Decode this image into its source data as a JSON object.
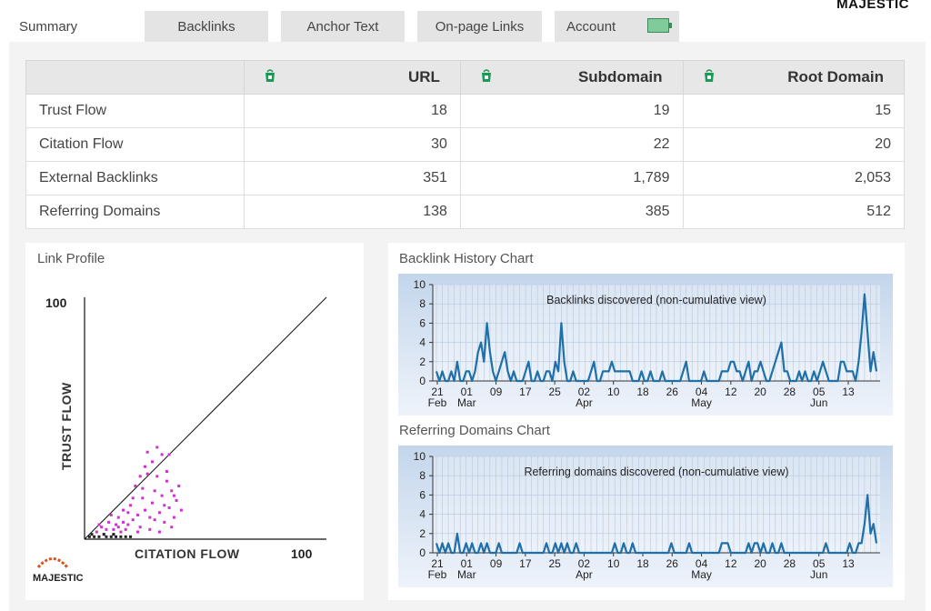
{
  "brand": "MAJESTIC",
  "tabs": [
    {
      "label": "Summary",
      "active": true
    },
    {
      "label": "Backlinks",
      "active": false
    },
    {
      "label": "Anchor Text",
      "active": false
    },
    {
      "label": "On-page Links",
      "active": false
    },
    {
      "label": "Account",
      "active": false,
      "icon": "battery-icon"
    }
  ],
  "metrics_table": {
    "columns": [
      "URL",
      "Subdomain",
      "Root Domain"
    ],
    "column_icon": "bucket-icon",
    "rows": [
      {
        "label": "Trust Flow",
        "values": [
          "18",
          "19",
          "15"
        ]
      },
      {
        "label": "Citation Flow",
        "values": [
          "30",
          "22",
          "20"
        ]
      },
      {
        "label": "External Backlinks",
        "values": [
          "351",
          "1,789",
          "2,053"
        ]
      },
      {
        "label": "Referring Domains",
        "values": [
          "138",
          "385",
          "512"
        ]
      }
    ]
  },
  "link_profile": {
    "title": "Link Profile",
    "y_label": "TRUST FLOW",
    "x_label": "CITATION FLOW",
    "y_max_label": "100",
    "x_max_label": "100",
    "logo_text": "MAJESTIC",
    "dot_color": "#cc33cc",
    "points": [
      [
        5,
        3
      ],
      [
        7,
        5
      ],
      [
        8,
        2
      ],
      [
        10,
        7
      ],
      [
        12,
        4
      ],
      [
        14,
        9
      ],
      [
        15,
        3
      ],
      [
        16,
        12
      ],
      [
        18,
        6
      ],
      [
        19,
        14
      ],
      [
        20,
        8
      ],
      [
        21,
        22
      ],
      [
        22,
        10
      ],
      [
        23,
        5
      ],
      [
        24,
        17
      ],
      [
        25,
        12
      ],
      [
        26,
        27
      ],
      [
        27,
        9
      ],
      [
        28,
        15
      ],
      [
        29,
        20
      ],
      [
        30,
        26
      ],
      [
        31,
        11
      ],
      [
        32,
        18
      ],
      [
        33,
        7
      ],
      [
        34,
        24
      ],
      [
        35,
        13
      ],
      [
        36,
        20
      ],
      [
        37,
        9
      ],
      [
        38,
        16
      ],
      [
        39,
        22
      ],
      [
        40,
        12
      ],
      [
        23,
        26
      ],
      [
        25,
        30
      ],
      [
        26,
        36
      ],
      [
        28,
        32
      ],
      [
        30,
        38
      ],
      [
        32,
        35
      ],
      [
        34,
        28
      ],
      [
        35,
        35
      ],
      [
        24,
        21
      ],
      [
        20,
        17
      ],
      [
        18,
        11
      ],
      [
        16,
        7
      ],
      [
        14,
        5
      ],
      [
        12,
        2
      ],
      [
        9,
        4
      ],
      [
        6,
        6
      ],
      [
        11,
        10
      ],
      [
        13,
        6
      ],
      [
        17,
        4
      ],
      [
        22,
        3
      ],
      [
        27,
        4
      ],
      [
        31,
        3
      ],
      [
        36,
        5
      ],
      [
        29,
        8
      ],
      [
        33,
        14
      ],
      [
        37,
        18
      ]
    ],
    "dark_points": [
      [
        2,
        1
      ],
      [
        3,
        2
      ],
      [
        4,
        1
      ],
      [
        6,
        1
      ],
      [
        9,
        1
      ],
      [
        11,
        1
      ],
      [
        13,
        1
      ],
      [
        15,
        1
      ],
      [
        17,
        1
      ],
      [
        19,
        1
      ],
      [
        8,
        2
      ],
      [
        12,
        2
      ]
    ]
  },
  "backlink_history": {
    "title": "Backlink History Chart",
    "chart_data": {
      "type": "line",
      "title": "Backlinks discovered (non-cumulative view)",
      "ylim": [
        0,
        10
      ],
      "yticks": [
        "0",
        "2",
        "4",
        "6",
        "8",
        "10"
      ],
      "xticks": [
        {
          "day": "21",
          "month": "Feb"
        },
        {
          "day": "01",
          "month": "Mar"
        },
        {
          "day": "09",
          "month": ""
        },
        {
          "day": "17",
          "month": ""
        },
        {
          "day": "25",
          "month": ""
        },
        {
          "day": "02",
          "month": "Apr"
        },
        {
          "day": "10",
          "month": ""
        },
        {
          "day": "18",
          "month": ""
        },
        {
          "day": "26",
          "month": ""
        },
        {
          "day": "04",
          "month": "May"
        },
        {
          "day": "12",
          "month": ""
        },
        {
          "day": "20",
          "month": ""
        },
        {
          "day": "28",
          "month": ""
        },
        {
          "day": "05",
          "month": "Jun"
        },
        {
          "day": "13",
          "month": ""
        }
      ],
      "series": [
        {
          "values": [
            1,
            0,
            1,
            0,
            0,
            1,
            0,
            2,
            0,
            0,
            1,
            1,
            0,
            1,
            3,
            4,
            2,
            6,
            3,
            1,
            0,
            1,
            2,
            3,
            1,
            0,
            1,
            0,
            0,
            0,
            1,
            2,
            0,
            0,
            1,
            0,
            0,
            1,
            1,
            0,
            2,
            1,
            6,
            2,
            0,
            0,
            1,
            0,
            0,
            0,
            0,
            0,
            1,
            2,
            0,
            0,
            1,
            1,
            1,
            2,
            1,
            1,
            1,
            1,
            1,
            1,
            0,
            0,
            0,
            1,
            0,
            0,
            1,
            0,
            0,
            0,
            1,
            0,
            0,
            0,
            0,
            0,
            0,
            1,
            2,
            0,
            0,
            0,
            0,
            0,
            1,
            0,
            0,
            0,
            0,
            0,
            1,
            1,
            1,
            2,
            2,
            1,
            1,
            0,
            1,
            2,
            0,
            1,
            1,
            2,
            1,
            0,
            0,
            1,
            2,
            3,
            4,
            1,
            1,
            0,
            0,
            0,
            1,
            0,
            1,
            0,
            0,
            1,
            0,
            1,
            2,
            1,
            0,
            0,
            0,
            0,
            2,
            2,
            1,
            1,
            1,
            0,
            2,
            5,
            9,
            5,
            1,
            3,
            1
          ]
        }
      ],
      "line_color": "#1f6fa8"
    }
  },
  "referring_domains": {
    "title": "Referring Domains Chart",
    "chart_data": {
      "type": "line",
      "title": "Referring domains discovered (non-cumulative view)",
      "ylim": [
        0,
        10
      ],
      "yticks": [
        "0",
        "2",
        "4",
        "6",
        "8",
        "10"
      ],
      "xticks": [
        {
          "day": "21",
          "month": "Feb"
        },
        {
          "day": "01",
          "month": "Mar"
        },
        {
          "day": "09",
          "month": ""
        },
        {
          "day": "17",
          "month": ""
        },
        {
          "day": "25",
          "month": ""
        },
        {
          "day": "02",
          "month": "Apr"
        },
        {
          "day": "10",
          "month": ""
        },
        {
          "day": "18",
          "month": ""
        },
        {
          "day": "26",
          "month": ""
        },
        {
          "day": "04",
          "month": "May"
        },
        {
          "day": "12",
          "month": ""
        },
        {
          "day": "20",
          "month": ""
        },
        {
          "day": "28",
          "month": ""
        },
        {
          "day": "05",
          "month": "Jun"
        },
        {
          "day": "13",
          "month": ""
        }
      ],
      "series": [
        {
          "values": [
            1,
            0,
            1,
            0,
            1,
            0,
            0,
            2,
            0,
            0,
            1,
            0,
            1,
            0,
            0,
            1,
            0,
            1,
            0,
            0,
            0,
            1,
            0,
            0,
            0,
            0,
            0,
            0,
            1,
            0,
            0,
            0,
            0,
            0,
            0,
            0,
            0,
            1,
            0,
            0,
            1,
            0,
            1,
            0,
            1,
            0,
            0,
            1,
            0,
            0,
            0,
            0,
            0,
            0,
            0,
            0,
            0,
            0,
            0,
            0,
            1,
            0,
            0,
            1,
            0,
            0,
            1,
            0,
            0,
            0,
            0,
            0,
            0,
            0,
            0,
            0,
            0,
            0,
            0,
            1,
            0,
            0,
            0,
            0,
            0,
            1,
            0,
            0,
            0,
            0,
            0,
            0,
            0,
            0,
            0,
            0,
            1,
            1,
            1,
            0,
            0,
            0,
            0,
            0,
            0,
            1,
            0,
            1,
            1,
            0,
            1,
            0,
            0,
            1,
            0,
            0,
            1,
            0,
            0,
            0,
            0,
            0,
            0,
            0,
            0,
            0,
            0,
            0,
            0,
            0,
            0,
            1,
            0,
            0,
            0,
            0,
            0,
            0,
            0,
            1,
            0,
            0,
            1,
            1,
            3,
            6,
            2,
            3,
            1
          ]
        }
      ],
      "line_color": "#1f6fa8"
    }
  }
}
